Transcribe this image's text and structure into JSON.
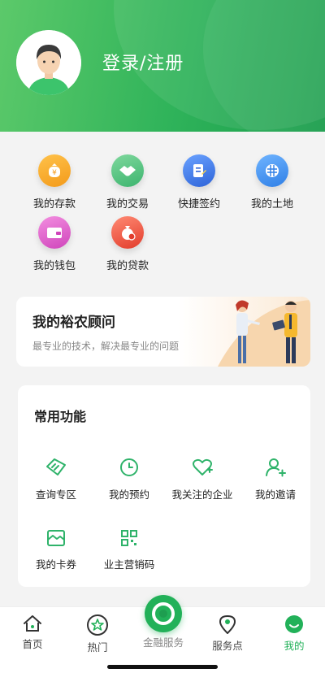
{
  "header": {
    "login_label": "登录/注册"
  },
  "quick_items": [
    {
      "label": "我的存款",
      "icon": "deposit-icon",
      "color": "#f6a623"
    },
    {
      "label": "我的交易",
      "icon": "handshake-icon",
      "color": "#4cbf7d"
    },
    {
      "label": "快捷签约",
      "icon": "sign-icon",
      "color": "#3f7be8"
    },
    {
      "label": "我的土地",
      "icon": "land-icon",
      "color": "#3a8ef0"
    },
    {
      "label": "我的钱包",
      "icon": "wallet-icon",
      "color": "#e15fc9"
    },
    {
      "label": "我的贷款",
      "icon": "loan-icon",
      "color": "#ee5845"
    }
  ],
  "advisor": {
    "title": "我的裕农顾问",
    "subtitle": "最专业的技术，解决最专业的问题"
  },
  "functions": {
    "title": "常用功能",
    "items": [
      {
        "label": "查询专区",
        "icon": "ticket-icon"
      },
      {
        "label": "我的预约",
        "icon": "clock-icon"
      },
      {
        "label": "我关注的企业",
        "icon": "heart-icon"
      },
      {
        "label": "我的邀请",
        "icon": "add-user-icon"
      },
      {
        "label": "我的卡券",
        "icon": "card-coupon-icon"
      },
      {
        "label": "业主营销码",
        "icon": "qr-code-icon"
      }
    ]
  },
  "tabbar": {
    "items": [
      {
        "label": "首页",
        "icon": "home-icon"
      },
      {
        "label": "热门",
        "icon": "hot-icon"
      },
      {
        "label": "金融服务",
        "icon": "finance-icon"
      },
      {
        "label": "服务点",
        "icon": "location-icon"
      },
      {
        "label": "我的",
        "icon": "me-icon"
      }
    ],
    "active": "我的",
    "accent": "#22b159"
  }
}
